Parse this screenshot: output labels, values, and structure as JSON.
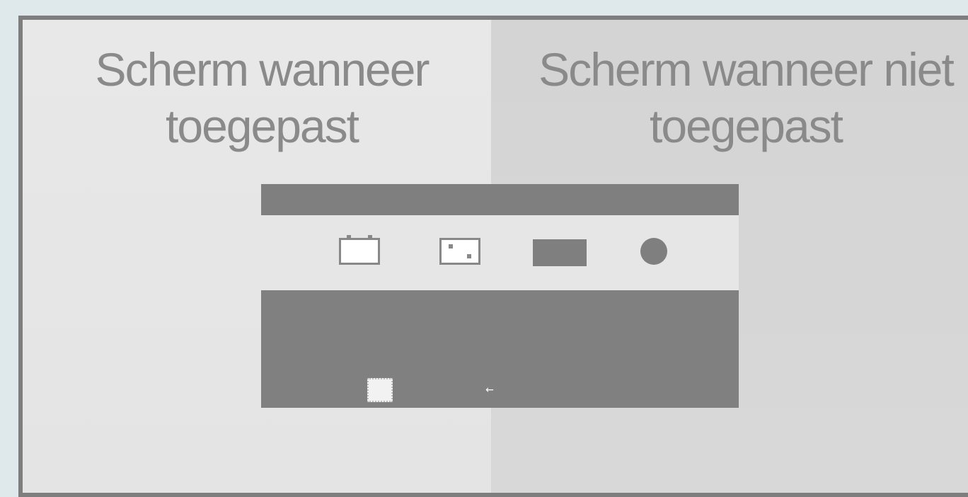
{
  "captions": {
    "applied_line1": "Scherm wanneer",
    "applied_line2": "toegepast",
    "not_applied_line1": "Scherm wanneer niet",
    "not_applied_line2": "toegepast"
  },
  "osd": {
    "icons": [
      "monitor-icon",
      "geometry-icon",
      "bar-icon",
      "dot-icon",
      "select-icon",
      "arrow-left-icon"
    ],
    "arrow_glyph": "←"
  }
}
